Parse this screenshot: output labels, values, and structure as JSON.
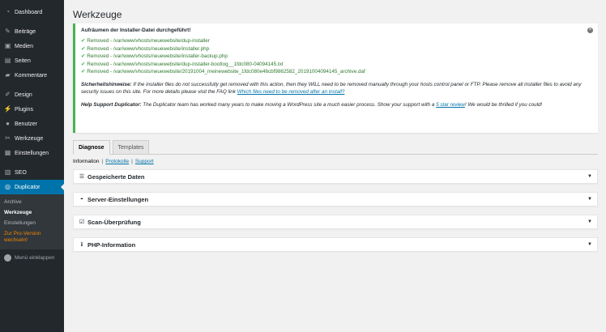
{
  "sidebar": {
    "dashboard": "Dashboard",
    "posts": "Beiträge",
    "media": "Medien",
    "pages": "Seiten",
    "comments": "Kommentare",
    "design": "Design",
    "plugins": "Plugins",
    "users": "Benutzer",
    "tools": "Werkzeuge",
    "settings": "Einstellungen",
    "seo": "SEO",
    "duplicator": "Duplicator",
    "sub": {
      "archive": "Archive",
      "tools": "Werkzeuge",
      "settings": "Einstellungen",
      "pro": "Zur Pro-Version wechseln!"
    },
    "collapse": "Menü einklappen"
  },
  "page": {
    "title": "Werkzeuge"
  },
  "notice": {
    "title": "Aufräumen der Installer-Datei durchgeführt!",
    "removed": [
      "Removed - /var/www/vhosts/neuewebsite/dup-installer",
      "Removed - /var/www/vhosts/neuewebsite/installer.php",
      "Removed - /var/www/vhosts/neuewebsite/installer-backup.php",
      "Removed - /var/www/vhosts/neuewebsite/dup-installer-bootlog__1fdc080-04094145.txt",
      "Removed - /var/www/vhosts/neuewebsite/20191004_meinewebsite_1fdc080e46cbf9862582_20191004094145_archive.daf"
    ],
    "security_label": "Sicherheitshinweise:",
    "security_text": " If the installer files do not successfully get removed with this action, then they WILL need to be removed manually through your hosts control panel or FTP. Please remove all installer files to avoid any security issues on this site. For more details please visit the FAQ link ",
    "security_link": "Which files need to be removed after an install?",
    "support_label": "Help Support Duplicator:",
    "support_text": " The Duplicator team has worked many years to make moving a WordPress site a much easier process. Show your support with a ",
    "support_link": "5 star review",
    "support_end": "! We would be thrilled if you could!"
  },
  "tabs": [
    {
      "label": "Diagnose"
    },
    {
      "label": "Templates"
    }
  ],
  "subnav": {
    "current": "Information",
    "sep": "|",
    "protocols": "Protokolle",
    "support": "Support"
  },
  "panels": [
    {
      "title": "Gespeicherte Daten"
    },
    {
      "title": "Server-Einstellungen"
    },
    {
      "title": "Scan-Überprüfung"
    },
    {
      "title": "PHP-Information"
    }
  ]
}
